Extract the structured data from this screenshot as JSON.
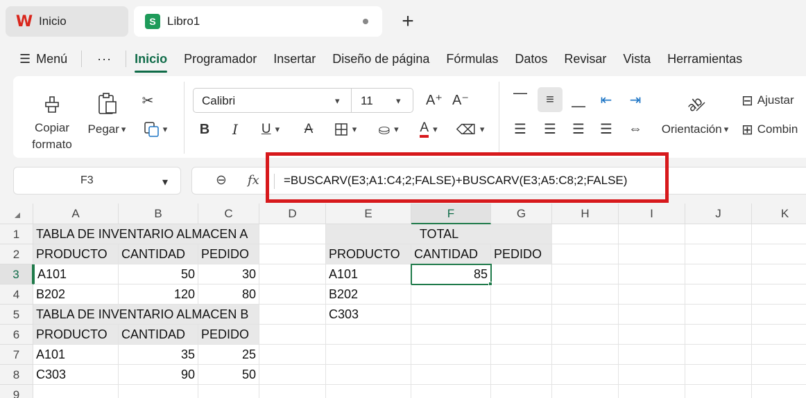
{
  "tabs": {
    "home": "Inicio",
    "book": "Libro1",
    "new_tab": "+"
  },
  "menu": {
    "menu_label": "Menú",
    "more": "···",
    "items": [
      "Inicio",
      "Programador",
      "Insertar",
      "Diseño de página",
      "Fórmulas",
      "Datos",
      "Revisar",
      "Vista",
      "Herramientas"
    ],
    "active": "Inicio"
  },
  "ribbon": {
    "copy_format_line1": "Copiar",
    "copy_format_line2": "formato",
    "paste": "Pegar",
    "font_name": "Calibri",
    "font_size": "11",
    "orientation": "Orientación",
    "wrap": "Ajustar",
    "merge": "Combin"
  },
  "formula_bar": {
    "name_box": "F3",
    "fx": "fx",
    "formula": "=BUSCARV(E3;A1:C4;2;FALSE)+BUSCARV(E3;A5:C8;2;FALSE)"
  },
  "grid": {
    "columns": [
      "A",
      "B",
      "C",
      "D",
      "E",
      "F",
      "G",
      "H",
      "I",
      "J",
      "K"
    ],
    "rows": [
      "1",
      "2",
      "3",
      "4",
      "5",
      "6",
      "7",
      "8",
      "9"
    ],
    "selected_column": "F",
    "selected_row": "3",
    "cells": {
      "A1": "TABLA DE INVENTARIO ALMACEN A",
      "A2": "PRODUCTO",
      "B2": "CANTIDAD",
      "C2": "PEDIDO",
      "A3": "A101",
      "B3": "50",
      "C3": "30",
      "A4": "B202",
      "B4": "120",
      "C4": "80",
      "A5": "TABLA DE INVENTARIO ALMACEN B",
      "A6": "PRODUCTO",
      "B6": "CANTIDAD",
      "C6": "PEDIDO",
      "A7": "A101",
      "B7": "35",
      "C7": "25",
      "A8": "C303",
      "B8": "90",
      "C8": "50",
      "F1": "TOTAL",
      "E2": "PRODUCTO",
      "F2": "CANTIDAD",
      "G2": "PEDIDO",
      "E3": "A101",
      "F3": "85",
      "E4": "B202",
      "E5": "C303"
    }
  },
  "colors": {
    "accent": "#0f6b48",
    "highlight_box": "#d7191c",
    "header_fill": "#e8e8e8"
  }
}
